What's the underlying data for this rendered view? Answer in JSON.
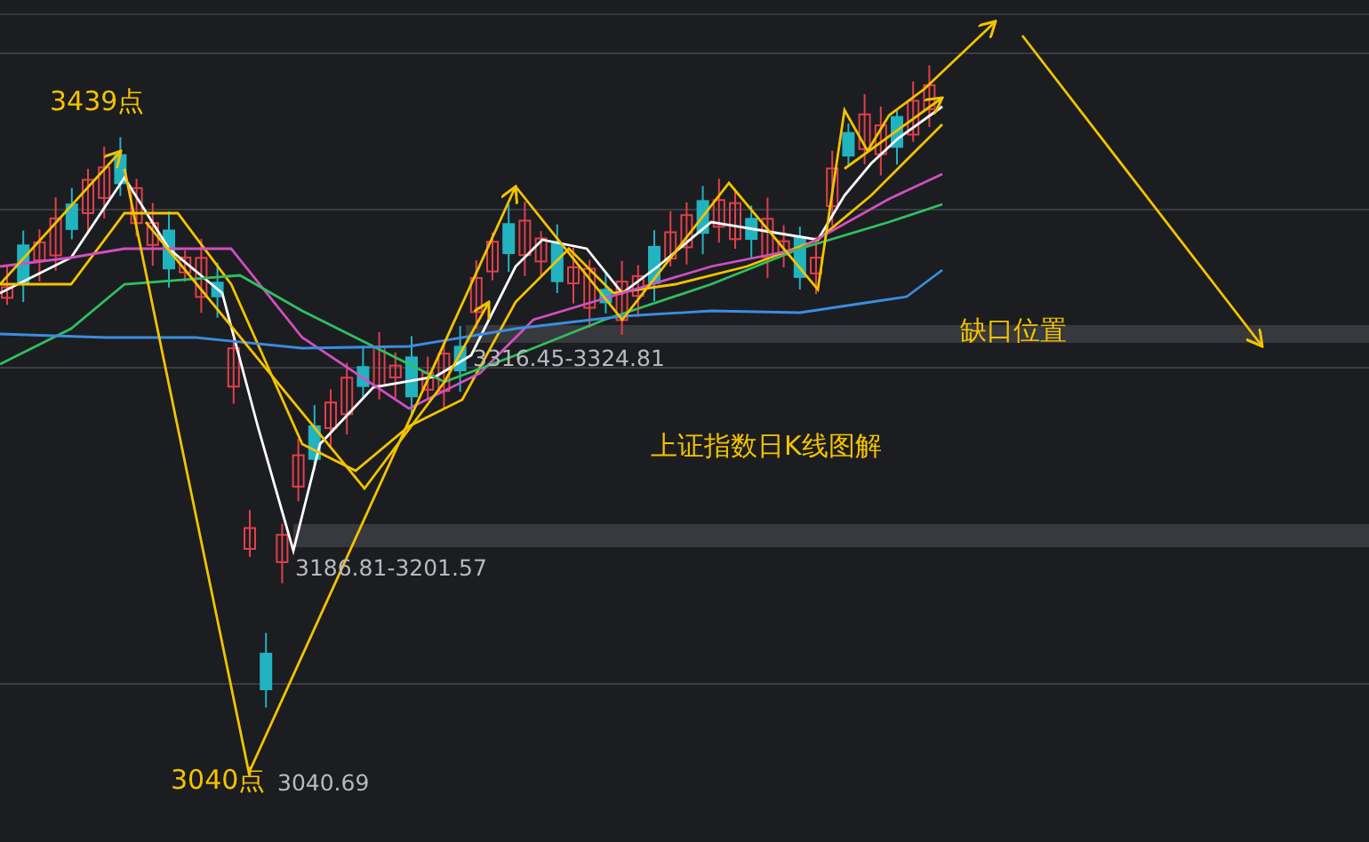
{
  "chart": {
    "title": "上证指数日K线图解",
    "labels": [
      {
        "kind": "callout",
        "text": "3439点"
      },
      {
        "kind": "price",
        "text": "3316.45-3324.81"
      },
      {
        "kind": "callout",
        "text": "缺口位置"
      },
      {
        "kind": "price",
        "text": "3186.81-3201.57"
      },
      {
        "kind": "callout",
        "text": "3040点"
      },
      {
        "kind": "price",
        "text": "3040.69"
      }
    ]
  }
}
